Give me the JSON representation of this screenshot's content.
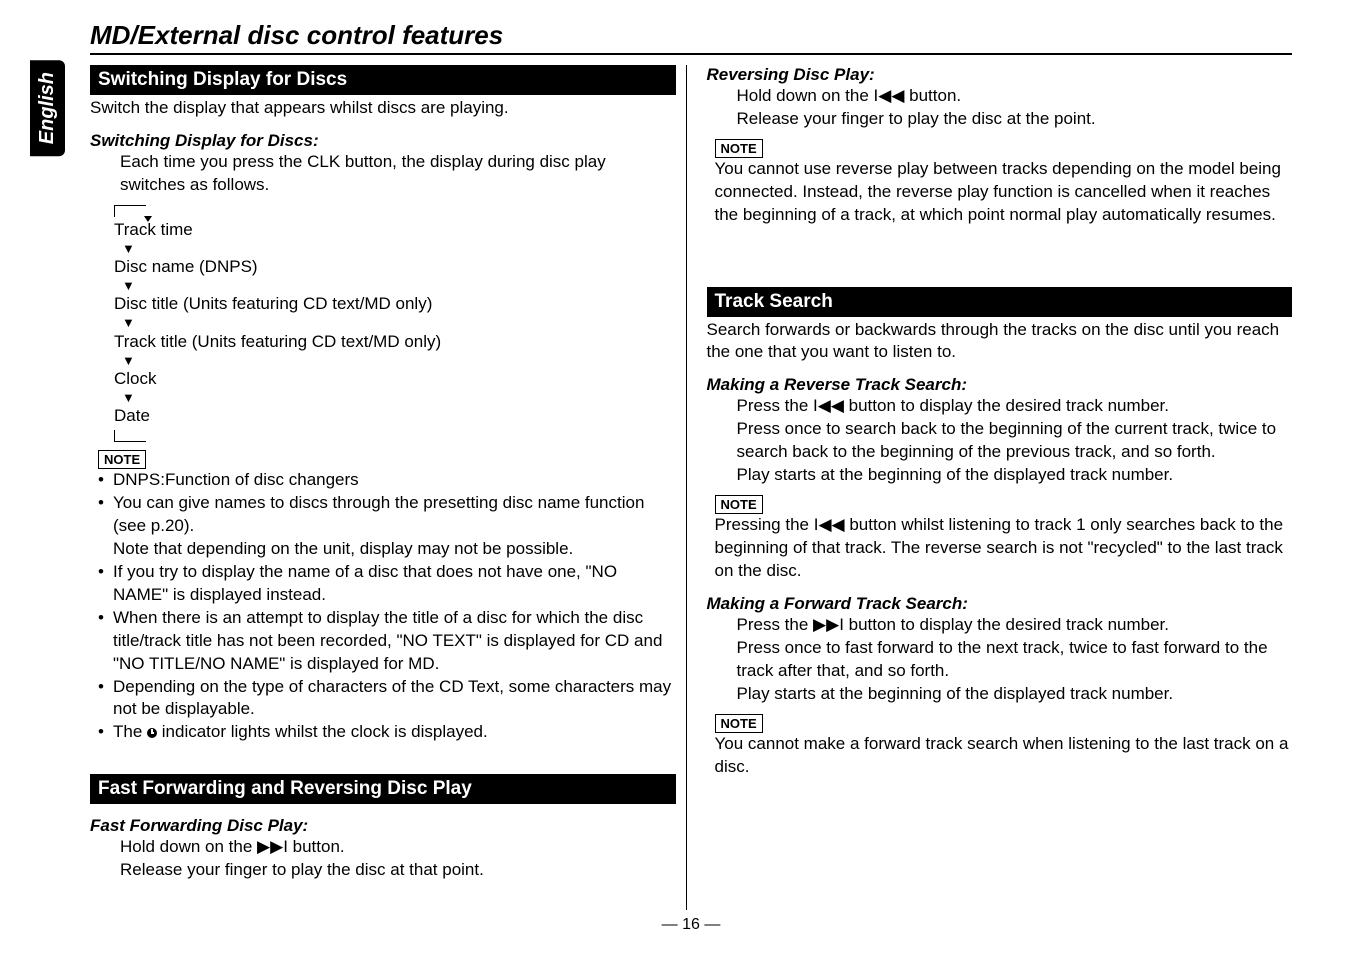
{
  "lang_tab": "English",
  "page_title": "MD/External disc control features",
  "page_num": "— 16 —",
  "icons": {
    "prev": "I◀◀",
    "next": "▶▶I",
    "down": "▼"
  },
  "note_label": "NOTE",
  "s1": {
    "header": "Switching Display for Discs",
    "sub": "Switch the display that appears whilst discs are playing.",
    "action": "Switching Display for Discs:",
    "body": "Each time you press the CLK button, the display during disc play switches as follows.",
    "flow": [
      "Track time",
      "Disc name (DNPS)",
      "Disc title (Units featuring CD text/MD only)",
      "Track title (Units featuring CD text/MD only)",
      "Clock",
      "Date"
    ],
    "notes": {
      "n1": "DNPS:Function of disc changers",
      "n2a": "You can give names to discs through the presetting disc name function (see p.20).",
      "n2b": "Note that depending on the unit, display may not be possible.",
      "n3": "If you try to display the name of a disc that does not have one, \"NO NAME\" is displayed instead.",
      "n4": "When there is an attempt to display the title of a disc for which the disc title/track title has not been recorded, \"NO TEXT\" is displayed for CD and \"NO TITLE/NO NAME\" is displayed for MD.",
      "n5": "Depending on the type of characters of the CD Text, some characters may not be displayable.",
      "n6a": "The ",
      "n6b": " indicator lights whilst the clock is displayed."
    }
  },
  "s2": {
    "header": "Fast Forwarding and Reversing Disc Play",
    "fwd_title": "Fast Forwarding Disc Play:",
    "fwd_b1a": "Hold down on the ",
    "fwd_b1b": " button.",
    "fwd_b2": "Release your finger to play the disc at that point.",
    "rev_title": "Reversing Disc Play:",
    "rev_b1a": "Hold down on the ",
    "rev_b1b": " button.",
    "rev_b2": "Release your finger to play the disc at the point.",
    "note": "You cannot use reverse play between tracks depending on the model being connected. Instead, the reverse play function is cancelled when it reaches the beginning of a track, at which point normal play automatically resumes."
  },
  "s3": {
    "header": "Track Search",
    "sub": "Search forwards or backwards through the tracks on the disc until you reach the one that you want to listen to.",
    "r_title": "Making a Reverse Track Search:",
    "r_b1a": "Press the ",
    "r_b1b": " button to display the desired track number.",
    "r_b2": "Press once to search back to the beginning of the current track, twice to search back to the beginning of the previous track, and so forth.",
    "r_b3": "Play starts at the beginning of the displayed track number.",
    "r_note_a": "Pressing the ",
    "r_note_b": " button whilst listening to track 1 only searches back to the beginning of that track. The reverse search is not \"recycled\" to the last track on the disc.",
    "f_title": "Making a Forward Track Search:",
    "f_b1a": "Press the ",
    "f_b1b": " button to display the desired track number.",
    "f_b2": "Press once to fast forward to the next track, twice to fast forward to the track after that, and so forth.",
    "f_b3": "Play starts at the beginning of the displayed track number.",
    "f_note": "You cannot make a forward track search when listening to the last track on a disc."
  }
}
